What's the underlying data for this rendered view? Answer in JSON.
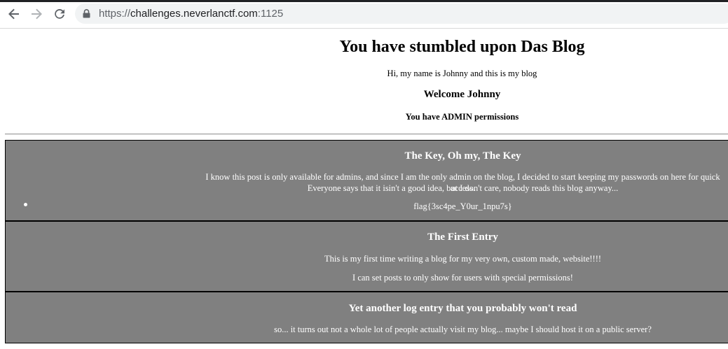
{
  "browser": {
    "url_scheme": "https://",
    "url_host": "challenges.neverlanctf.com",
    "url_port": ":1125",
    "icons": [
      "back-arrow-icon",
      "forward-arrow-icon",
      "reload-icon",
      "lock-icon"
    ]
  },
  "header": {
    "title": "You have stumbled upon Das Blog",
    "intro": "Hi, my name is Johnny and this is my blog",
    "welcome": "Welcome Johnny",
    "permissions": "You have ADMIN permissions"
  },
  "posts": [
    {
      "title": "The Key, Oh my, The Key",
      "body_line1": "I know this post is only available for admins, and since I am the only admin on the blog, I decided to start keeping my passwords on here for quick access.",
      "body_line2": "Everyone says that it isin't a good idea, but I don't care, nobody reads this blog anyway...",
      "list_item": "flag{3sc4pe_Y0ur_1npu7s}"
    },
    {
      "title": "The First Entry",
      "para1": "This is my first time writing a blog for my very own, custom made, website!!!!",
      "para2": "I can set posts to only show for users with special permissions!"
    },
    {
      "title": "Yet another log entry that you probably won't read",
      "para1": "so... it turns out not a whole lot of people actually visit my blog... maybe I should host it on a public server?"
    }
  ],
  "colors": {
    "post_background": "#808080",
    "post_text": "#ffffff",
    "chrome_background": "#ffffff",
    "omnibox_background": "#f1f3f4"
  }
}
